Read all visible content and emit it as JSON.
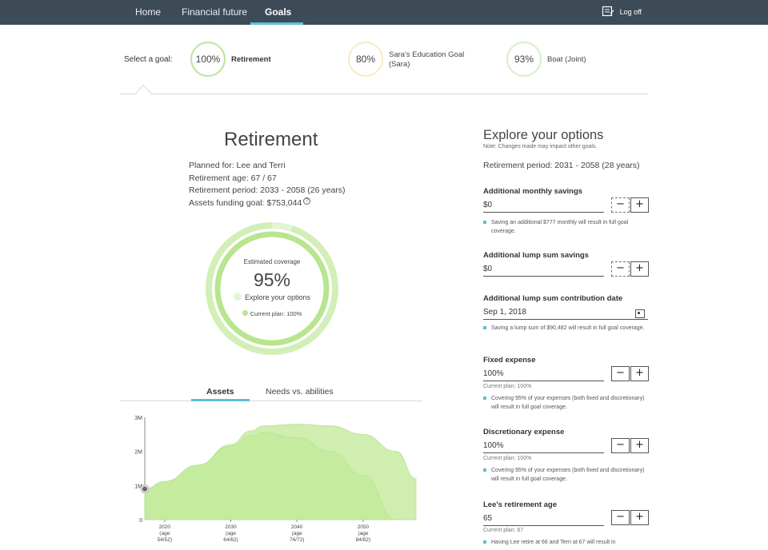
{
  "nav": {
    "tabs": [
      {
        "label": "Home"
      },
      {
        "label": "Financial future"
      },
      {
        "label": "Goals"
      }
    ],
    "logoff": "Log off",
    "accent": "#5bc0d8",
    "background": "#3d4b57"
  },
  "goal_selector": {
    "label": "Select a goal:",
    "goals": [
      {
        "percent": "100%",
        "name": "Retirement",
        "color": "#b9e59a"
      },
      {
        "percent": "80%",
        "name_line1": "Sara's Education Goal",
        "name_line2": "(Sara)",
        "color": "#f6ecc2"
      },
      {
        "percent": "93%",
        "name": "Boat (Joint)",
        "color": "#d8efc6"
      }
    ]
  },
  "goal_detail": {
    "title": "Retirement",
    "planned_for": "Planned for:  Lee and Terri",
    "retirement_age": "Retirement age:  67 / 67",
    "retirement_period": "Retirement period:  2033 - 2058 (26 years)",
    "assets_goal": "Assets funding goal:  $753,044",
    "help_icon": "question-icon"
  },
  "coverage": {
    "label": "Estimated coverage",
    "value": "95%",
    "value_number": 95,
    "explore_legend": "Explore your options",
    "current_legend": "Current plan: 100%",
    "current_number": 100,
    "ring_outer_color": "#d7f1c2",
    "ring_inner_color": "#b8e58f"
  },
  "chart_tabs": {
    "assets": "Assets",
    "needs": "Needs vs. abilities"
  },
  "chart_data": {
    "type": "area",
    "ylabel_ticks": [
      "0",
      "1M",
      "2M",
      "3M"
    ],
    "ylim": [
      0,
      3000000
    ],
    "xlim": [
      2017,
      2058
    ],
    "x_ticks": [
      {
        "year": 2020,
        "line1": "2020",
        "line2": "(age",
        "line3": "54/52)"
      },
      {
        "year": 2030,
        "line1": "2030",
        "line2": "(age",
        "line3": "64/62)"
      },
      {
        "year": 2040,
        "line1": "2040",
        "line2": "(age",
        "line3": "74/72)"
      },
      {
        "year": 2050,
        "line1": "2050",
        "line2": "(age",
        "line3": "84/82)"
      }
    ],
    "series": [
      {
        "x": [
          2017,
          2020,
          2025,
          2030,
          2033,
          2035,
          2040,
          2045,
          2050,
          2055,
          2058
        ],
        "y": [
          900000,
          1120000,
          1600000,
          2200000,
          2600000,
          2750000,
          2800000,
          2750000,
          2500000,
          2000000,
          1200000
        ],
        "color": "#cfeeb0"
      },
      {
        "x": [
          2017,
          2020,
          2025,
          2030,
          2033,
          2035,
          2040,
          2045,
          2050,
          2055,
          2058
        ],
        "y": [
          900000,
          1120000,
          1600000,
          2150000,
          2450000,
          2550000,
          2400000,
          2000000,
          1300000,
          0,
          0
        ],
        "color": "#c3ea9c"
      }
    ],
    "current_point": {
      "x": 2017,
      "y": 900000
    }
  },
  "options": {
    "title": "Explore your options",
    "note": "Note: Changes made may impact other goals.",
    "period": "Retirement period: 2031 - 2058 (28 years)",
    "monthly_savings": {
      "label": "Additional monthly savings",
      "value": "$0",
      "hint": "Saving an additional $777 monthly will result in full goal coverage."
    },
    "lump_sum": {
      "label": "Additional lump sum savings",
      "value": "$0"
    },
    "lump_date": {
      "label": "Additional lump sum contribution date",
      "value": "Sep 1, 2018",
      "hint": "Saving a lump sum of $90,482 will result in full goal coverage."
    },
    "fixed_expense": {
      "label": "Fixed expense",
      "value": "100%",
      "current": "Current plan: 100%",
      "hint": "Covering 95% of your expenses (both fixed and discretionary) will result in full goal coverage."
    },
    "discretionary_expense": {
      "label": "Discretionary expense",
      "value": "100%",
      "current": "Current plan: 100%",
      "hint": "Covering 95% of your expenses (both fixed and discretionary) will result in full goal coverage."
    },
    "lee_age": {
      "label": "Lee's retirement age",
      "value": "65",
      "current": "Current plan: 67",
      "hint": "Having Lee retire at 66 and Terri at 67 will result in"
    },
    "minus": "−",
    "plus": "+"
  }
}
